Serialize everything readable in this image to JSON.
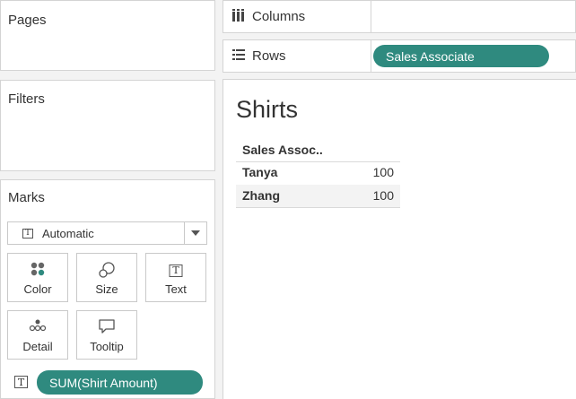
{
  "left_panel": {
    "pages_title": "Pages",
    "filters_title": "Filters",
    "marks_title": "Marks",
    "mark_type": "Automatic",
    "cards": [
      {
        "label": "Color",
        "icon": "color-dots-icon"
      },
      {
        "label": "Size",
        "icon": "size-circles-icon"
      },
      {
        "label": "Text",
        "icon": "text-t-icon"
      },
      {
        "label": "Detail",
        "icon": "detail-dots-icon"
      },
      {
        "label": "Tooltip",
        "icon": "tooltip-bubble-icon"
      }
    ],
    "mark_pill": "SUM(Shirt Amount)"
  },
  "shelves": {
    "columns_label": "Columns",
    "rows_label": "Rows",
    "rows_pill": "Sales Associate"
  },
  "view": {
    "title": "Shirts",
    "column_header": "Sales Assoc..",
    "rows": [
      {
        "label": "Tanya",
        "value": "100"
      },
      {
        "label": "Zhang",
        "value": "100"
      }
    ]
  },
  "colors": {
    "pill": "#2f8a7f",
    "border": "#d4d4d4",
    "band": "#f3f3f3"
  }
}
